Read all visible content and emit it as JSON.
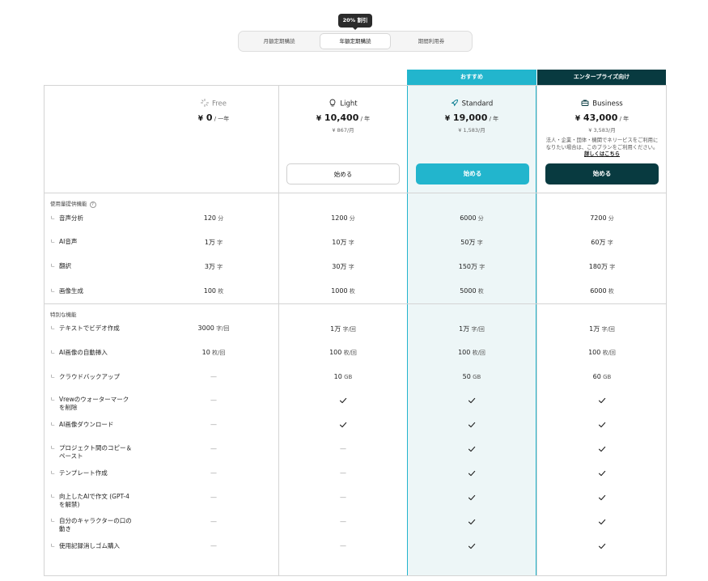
{
  "billing": {
    "discount_badge": "20% 割引",
    "options": [
      "月額定期購読",
      "年額定期購読",
      "期間利用券"
    ],
    "selected": "年額定期購読"
  },
  "tags": {
    "standard": "おすすめ",
    "business": "エンタープライズ向け"
  },
  "colors": {
    "accent": "#22b5cd",
    "dark": "#083a40",
    "standard_bg": "#edf6f7"
  },
  "plans": [
    {
      "name": "Free",
      "icon": "sparkle-icon",
      "currency": "¥",
      "price": "0",
      "per": " / 一年",
      "monthly": "",
      "button": ""
    },
    {
      "name": "Light",
      "icon": "lightbulb-icon",
      "currency": "¥",
      "price": "10,400",
      "per": " / 年",
      "monthly": "¥ 867/月",
      "button": "始める"
    },
    {
      "name": "Standard",
      "icon": "rocket-icon",
      "currency": "¥",
      "price": "19,000",
      "per": " / 年",
      "monthly": "¥ 1,583/月",
      "button": "始める"
    },
    {
      "name": "Business",
      "icon": "briefcase-icon",
      "currency": "¥",
      "price": "43,000",
      "per": " / 年",
      "monthly": "¥ 3,583/月",
      "button": "始める"
    }
  ],
  "business_note": {
    "text": "法人・企業・団体・機関でネリービスをご利用になりたい場合は、このプランをご利用ください。",
    "link": "詳しくはこちら"
  },
  "usage_section": {
    "title": "使用量提供機能",
    "help_icon": "?",
    "rows": [
      {
        "label": "音声分析",
        "values": [
          [
            "120",
            "分"
          ],
          [
            "1200",
            "分"
          ],
          [
            "6000",
            "分"
          ],
          [
            "7200",
            "分"
          ]
        ]
      },
      {
        "label": "AI音声",
        "values": [
          [
            "1万",
            "字"
          ],
          [
            "10万",
            "字"
          ],
          [
            "50万",
            "字"
          ],
          [
            "60万",
            "字"
          ]
        ]
      },
      {
        "label": "翻訳",
        "values": [
          [
            "3万",
            "字"
          ],
          [
            "30万",
            "字"
          ],
          [
            "150万",
            "字"
          ],
          [
            "180万",
            "字"
          ]
        ]
      },
      {
        "label": "画像生成",
        "values": [
          [
            "100",
            "枚"
          ],
          [
            "1000",
            "枚"
          ],
          [
            "5000",
            "枚"
          ],
          [
            "6000",
            "枚"
          ]
        ]
      }
    ]
  },
  "special_section": {
    "title": "特別な機能",
    "rows": [
      {
        "label": "テキストでビデオ作成",
        "values": [
          [
            "3000",
            "字/回"
          ],
          [
            "1万",
            "字/回"
          ],
          [
            "1万",
            "字/回"
          ],
          [
            "1万",
            "字/回"
          ]
        ]
      },
      {
        "label": "AI画像の自動挿入",
        "values": [
          [
            "10",
            "枚/回"
          ],
          [
            "100",
            "枚/回"
          ],
          [
            "100",
            "枚/回"
          ],
          [
            "100",
            "枚/回"
          ]
        ]
      },
      {
        "label": "クラウドバックアップ",
        "values": [
          "—",
          [
            "10",
            "GB"
          ],
          [
            "50",
            "GB"
          ],
          [
            "60",
            "GB"
          ]
        ]
      },
      {
        "label": "Vrewのウォーターマーク\nを削除",
        "values": [
          "—",
          "check",
          "check",
          "check"
        ]
      },
      {
        "label": "AI画像ダウンロード",
        "values": [
          "—",
          "check",
          "check",
          "check"
        ]
      },
      {
        "label": "プロジェクト間のコピー＆\nペースト",
        "values": [
          "—",
          "—",
          "check",
          "check"
        ]
      },
      {
        "label": "テンプレート作成",
        "values": [
          "—",
          "—",
          "check",
          "check"
        ]
      },
      {
        "label": "向上したAIで作文 (GPT-4\nを解禁)",
        "values": [
          "—",
          "—",
          "check",
          "check"
        ]
      },
      {
        "label": "自分のキャラクターの口の\n動き",
        "values": [
          "—",
          "—",
          "check",
          "check"
        ]
      },
      {
        "label": "使用記録消しゴム購入",
        "values": [
          "—",
          "—",
          "check",
          "check"
        ]
      }
    ]
  }
}
